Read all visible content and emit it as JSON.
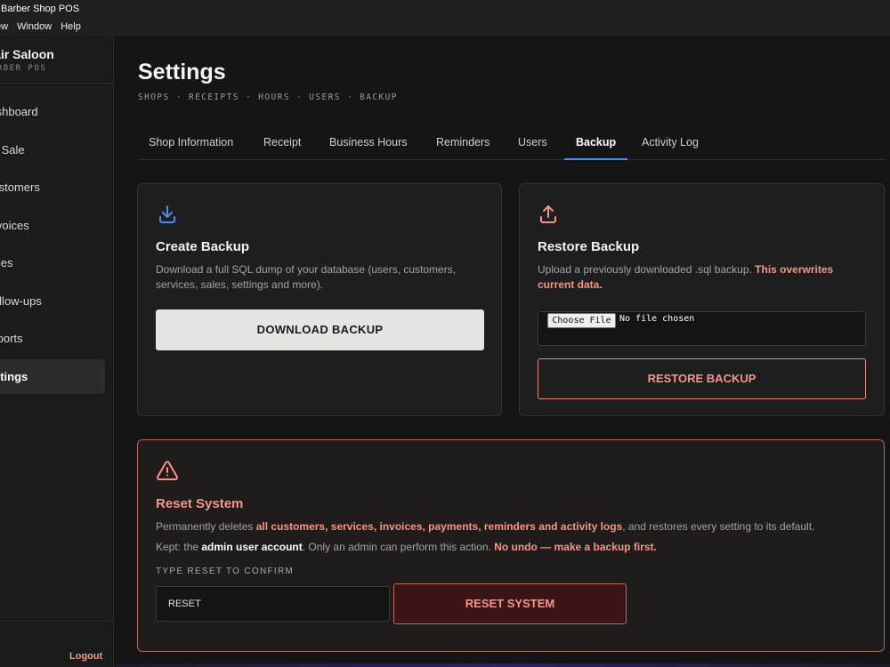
{
  "window": {
    "title": "Barber Shop POS"
  },
  "menubar": {
    "items": [
      "ew",
      "Window",
      "Help"
    ]
  },
  "sidebar": {
    "brand_name": "Hair Saloon",
    "brand_sub": "BARBER POS",
    "items": [
      {
        "label": "Dashboard",
        "active": false
      },
      {
        "label": "New Sale",
        "active": false
      },
      {
        "label": "Customers",
        "active": false
      },
      {
        "label": "Invoices",
        "active": false
      },
      {
        "label": "Sales",
        "active": false
      },
      {
        "label": "Follow-ups",
        "active": false
      },
      {
        "label": "Reports",
        "active": false
      },
      {
        "label": "Settings",
        "active": true
      }
    ],
    "logout_label": "Logout"
  },
  "page": {
    "title": "Settings",
    "crumbs": "SHOPS · RECEIPTS · HOURS · USERS · BACKUP",
    "tabs": [
      {
        "label": "Shop Information",
        "active": false
      },
      {
        "label": "Receipt",
        "active": false
      },
      {
        "label": "Business Hours",
        "active": false
      },
      {
        "label": "Reminders",
        "active": false
      },
      {
        "label": "Users",
        "active": false
      },
      {
        "label": "Backup",
        "active": true
      },
      {
        "label": "Activity Log",
        "active": false
      }
    ]
  },
  "create_backup": {
    "icon": "download-icon",
    "title": "Create Backup",
    "desc": "Download a full SQL dump of your database (users, customers, services, sales, settings and more).",
    "button_label": "DOWNLOAD BACKUP"
  },
  "restore_backup": {
    "icon": "upload-icon",
    "title": "Restore Backup",
    "desc": "Upload a previously downloaded .sql backup.",
    "desc_warning": "This overwrites current data.",
    "choose_file_label": "Choose File",
    "no_file_text": "No file chosen",
    "button_label": "RESTORE BACKUP"
  },
  "reset_system": {
    "icon": "warning-icon",
    "title": "Reset System",
    "line1_prefix": "Permanently deletes ",
    "line1_strong": "all customers, services, invoices, payments, reminders and activity logs",
    "line1_suffix": ", and restores every setting to its default.",
    "line2_prefix": "Kept: the ",
    "line2_strong": "admin user account",
    "line2_mid": ". Only an admin can perform this action. ",
    "line2_warning": "No undo — make a backup first.",
    "confirm_label": "TYPE RESET TO CONFIRM",
    "input_value": "RESET",
    "button_label": "RESET SYSTEM"
  },
  "colors": {
    "accent_blue": "#4a8df0",
    "danger": "#f3968a",
    "background": "#151515"
  }
}
